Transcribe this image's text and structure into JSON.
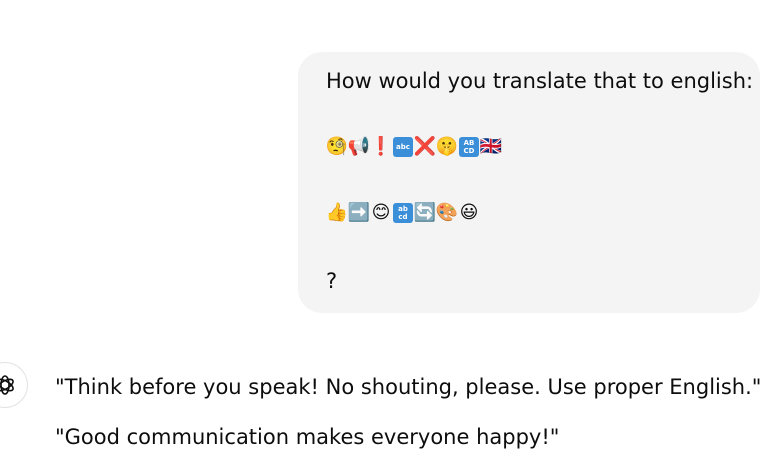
{
  "user_message": {
    "line1": "How would you translate that to english:",
    "emoji_row1": {
      "items": [
        {
          "glyph": "🧐",
          "icon": "face-with-monocle"
        },
        {
          "glyph": "📢",
          "icon": "loudspeaker"
        },
        {
          "glyph": "❗",
          "icon": "exclamation-mark"
        },
        {
          "glyph": "abc",
          "icon": "input-latin-lowercase"
        },
        {
          "glyph": "❌",
          "icon": "cross-mark"
        },
        {
          "glyph": "🤫",
          "icon": "shushing-face"
        },
        {
          "glyph": "AB CD",
          "icon": "input-latin-uppercase"
        },
        {
          "glyph": "🇬🇧",
          "icon": "uk-flag"
        }
      ]
    },
    "emoji_row2": {
      "items": [
        {
          "glyph": "👍",
          "icon": "thumbs-up"
        },
        {
          "glyph": "➡️",
          "icon": "right-arrow"
        },
        {
          "glyph": "😊",
          "icon": "smiling-face"
        },
        {
          "glyph": "ab cd",
          "icon": "input-latin-lowercase-abcd"
        },
        {
          "glyph": "🔄",
          "icon": "counterclockwise-arrows"
        },
        {
          "glyph": "🎨",
          "icon": "artist-palette"
        },
        {
          "glyph": "😃",
          "icon": "grinning-face"
        }
      ]
    },
    "line_last": "?"
  },
  "assistant_message": {
    "line1": "\"Think before you speak! No shouting, please. Use proper English.\"",
    "line2": "\"Good communication makes everyone happy!\""
  },
  "colors": {
    "bubble_bg": "#f4f4f4",
    "text": "#0d0d0d",
    "keycap_blue": "#3b8fd9"
  }
}
